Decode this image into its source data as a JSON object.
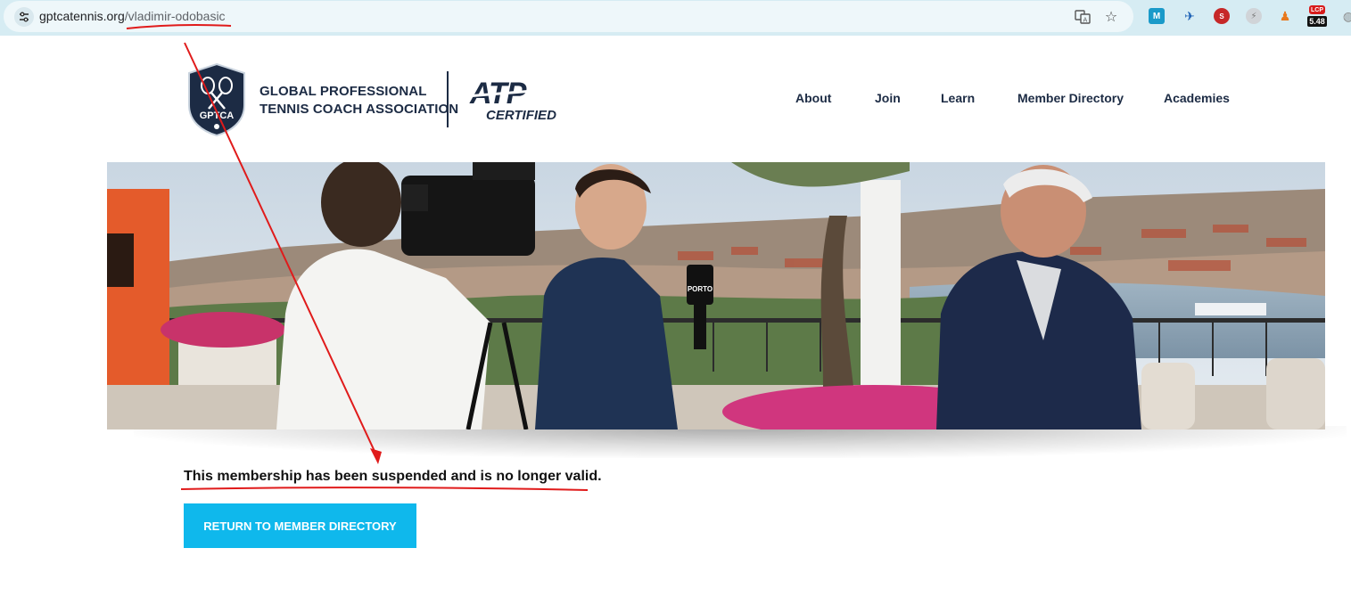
{
  "browser": {
    "url_domain": "gptcatennis.org",
    "url_path": "/vladimir-odobasic",
    "extension_badge": "5.48"
  },
  "header": {
    "logo_text": "GPTCA",
    "brand_line1": "GLOBAL PROFESSIONAL",
    "brand_line2": "TENNIS COACH ASSOCIATION",
    "atp_text": "ATP",
    "certified_text": "CERTIFIED",
    "nav": [
      {
        "label": "About"
      },
      {
        "label": "Join"
      },
      {
        "label": "Learn"
      },
      {
        "label": "Member Directory"
      },
      {
        "label": "Academies"
      }
    ]
  },
  "hero": {
    "mic_label": "PORTO"
  },
  "content": {
    "message": "This membership has been suspended and is no longer valid.",
    "button_label": "RETURN TO MEMBER DIRECTORY"
  },
  "colors": {
    "navy": "#1c2b44",
    "button": "#0fb8ec",
    "annotation": "#e01b1b",
    "chrome": "#d6ecf3"
  }
}
